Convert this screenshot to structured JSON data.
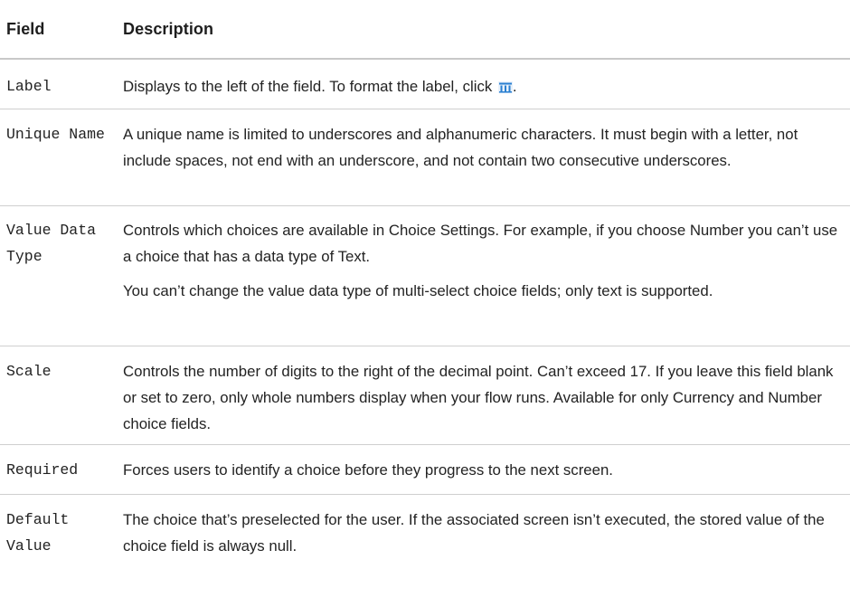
{
  "table": {
    "headers": {
      "field": "Field",
      "description": "Description"
    },
    "rows": [
      {
        "field": "Label",
        "description": [
          {
            "text": "Displays to the left of the field. To format the label, click ",
            "icon": "format-text-icon",
            "after": "."
          }
        ]
      },
      {
        "field": "Unique Name",
        "description": [
          {
            "text": "A unique name is limited to underscores and alphanumeric characters. It must begin with a letter, not include spaces, not end with an underscore, and not contain two consecutive underscores."
          }
        ]
      },
      {
        "field": "Value Data Type",
        "description": [
          {
            "text": "Controls which choices are available in Choice Settings. For example, if you choose Number you can’t use a choice that has a data type of Text."
          },
          {
            "text": "You can’t change the value data type of multi-select choice fields; only text is supported."
          }
        ]
      },
      {
        "field": "Scale",
        "description": [
          {
            "text": "Controls the number of digits to the right of the decimal point. Can’t exceed 17. If you leave this field blank or set to zero, only whole numbers display when your flow runs. Available for only Currency and Number choice fields."
          }
        ]
      },
      {
        "field": "Required",
        "description": [
          {
            "text": "Forces users to identify a choice before they progress to the next screen."
          }
        ]
      },
      {
        "field": "Default Value",
        "description": [
          {
            "text": "The choice that’s preselected for the user. If the associated screen isn’t executed, the stored value of the choice field is always null."
          }
        ]
      }
    ]
  },
  "colors": {
    "icon_blue": "#2a7fd0",
    "icon_bg": "#e8f1fb"
  }
}
